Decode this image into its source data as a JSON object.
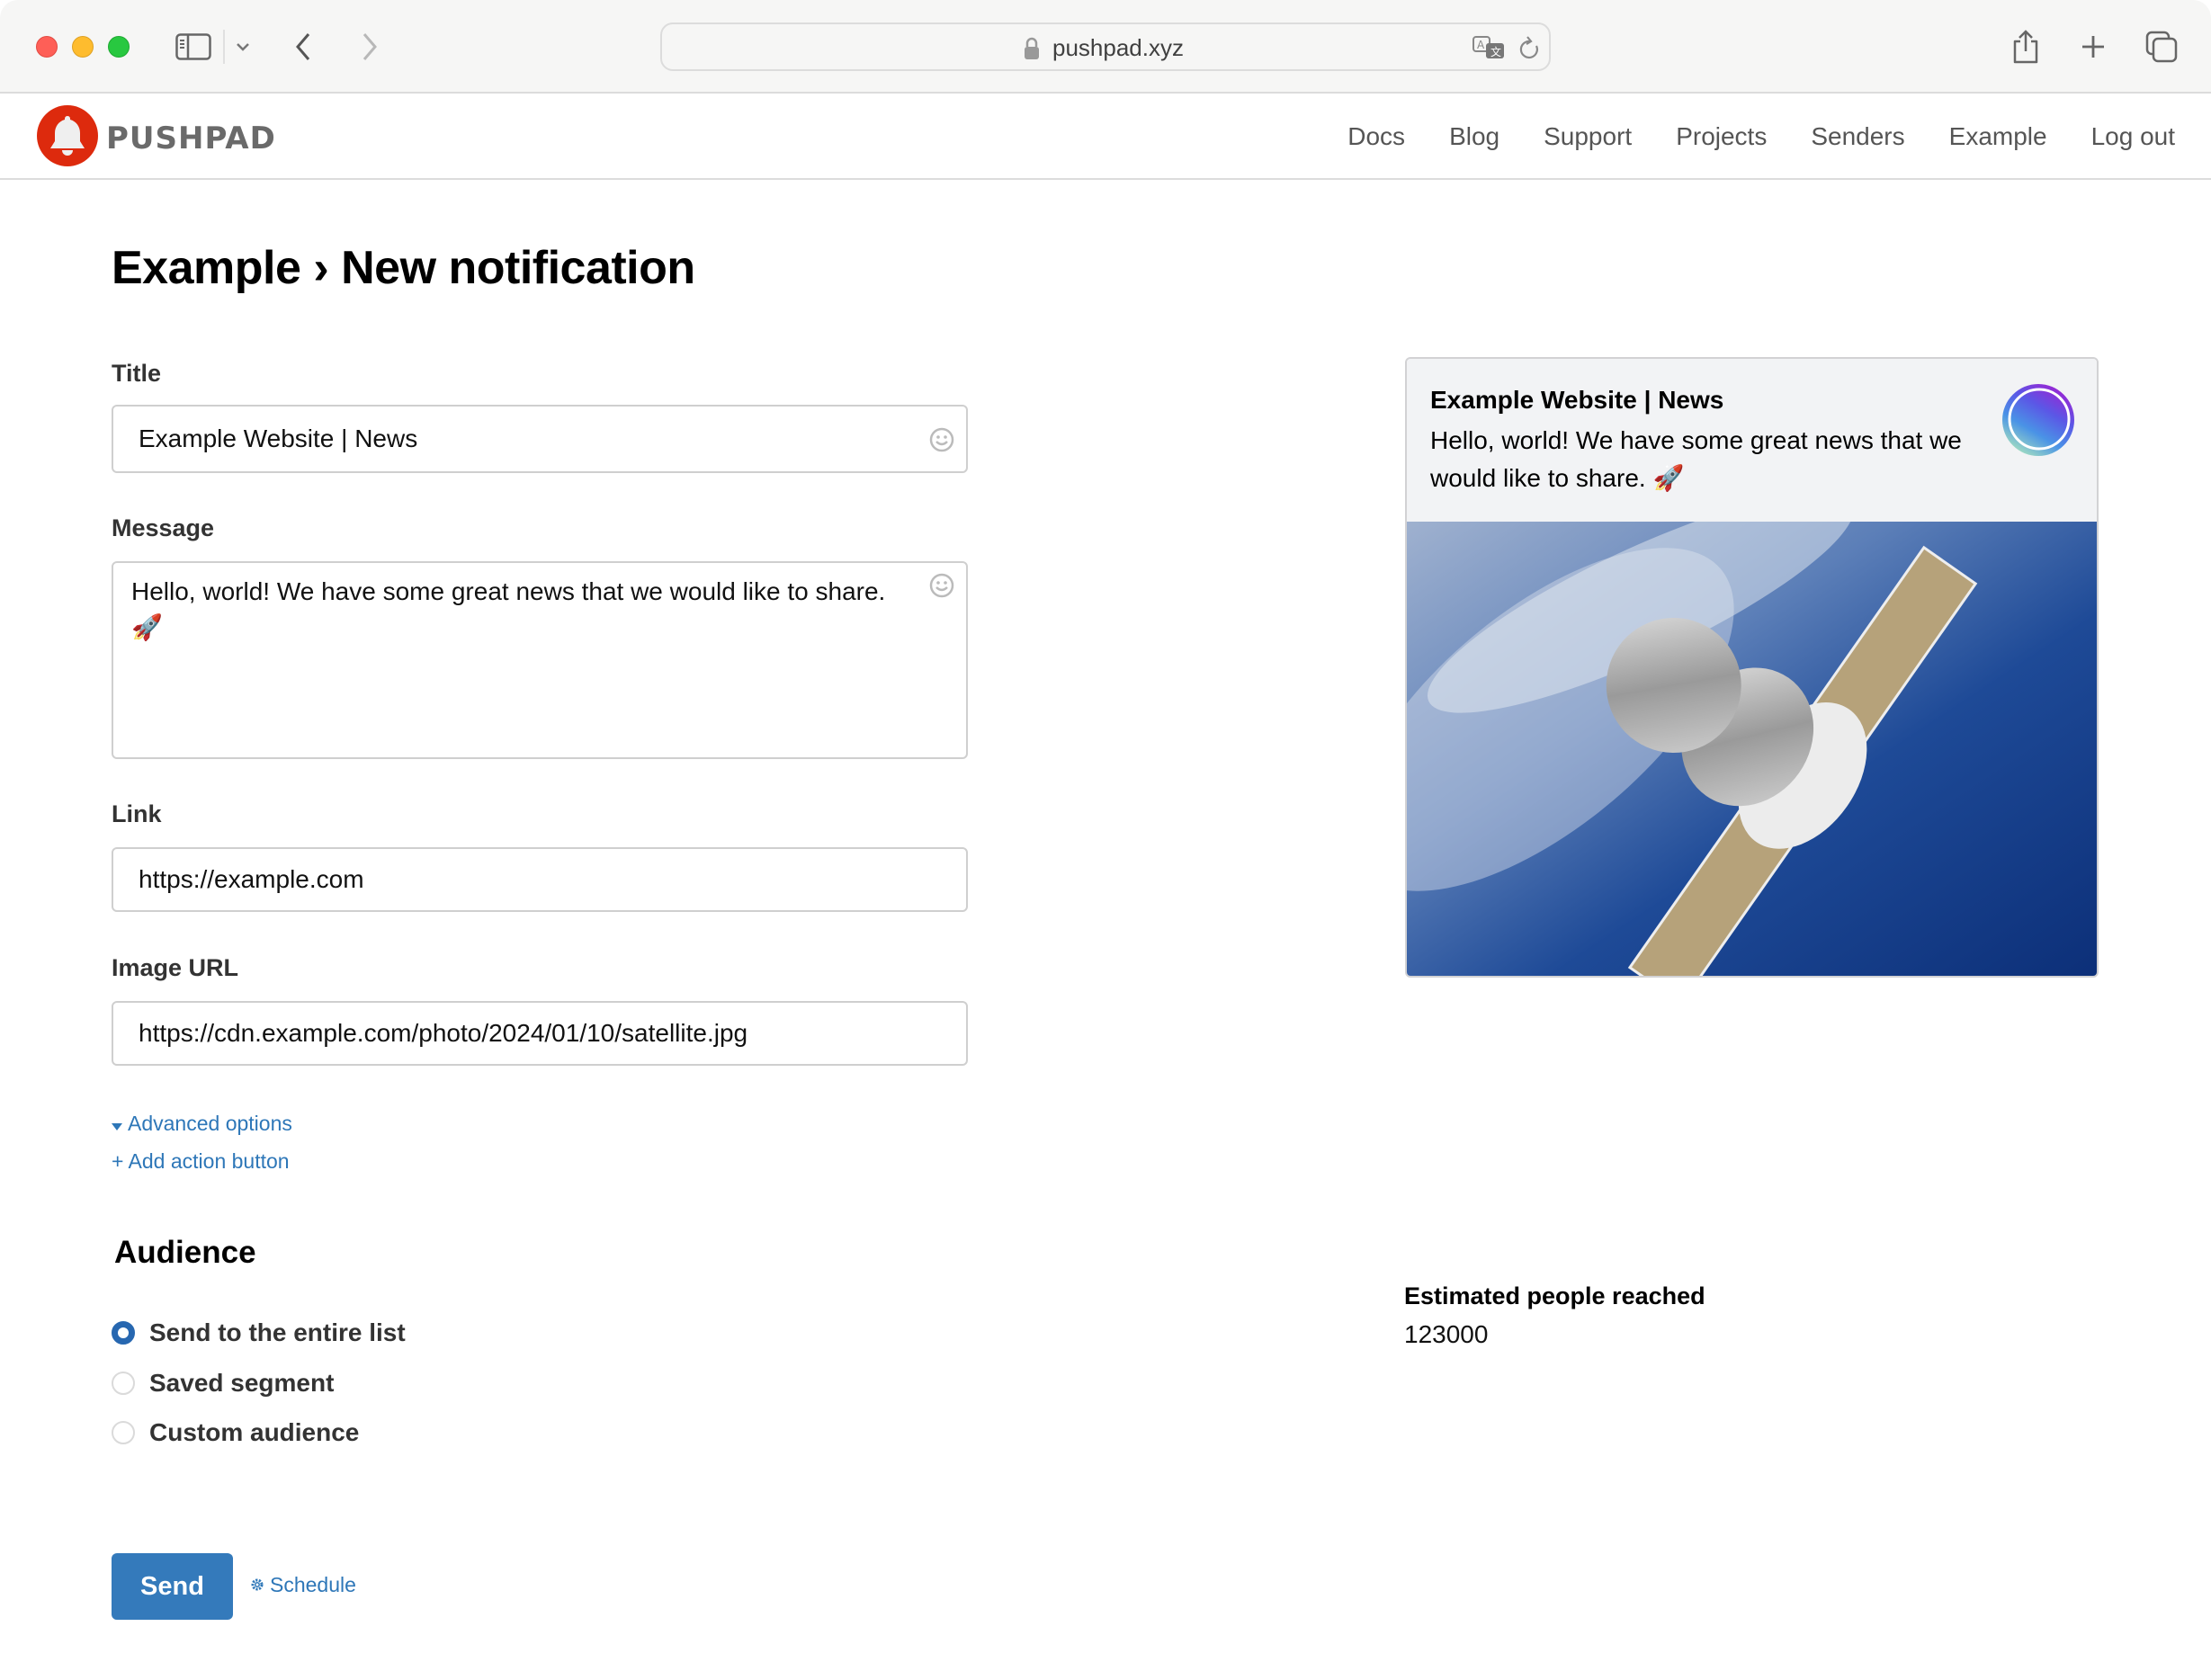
{
  "browser": {
    "url": "pushpad.xyz",
    "icons": {
      "sidebar": "sidebar-icon",
      "tab_overview_chevron": "chevron-down-icon",
      "back": "chevron-left-icon",
      "forward": "chevron-right-icon",
      "lock": "lock-icon",
      "translate": "translate-icon",
      "reload": "reload-icon",
      "share": "share-icon",
      "new_tab": "plus-icon",
      "tab_overview": "tabs-icon"
    }
  },
  "header": {
    "brand": "PUSHPAD",
    "brand_color": "#dd2a0d",
    "nav": [
      {
        "label": "Docs"
      },
      {
        "label": "Blog"
      },
      {
        "label": "Support"
      },
      {
        "label": "Projects"
      },
      {
        "label": "Senders"
      },
      {
        "label": "Example"
      },
      {
        "label": "Log out"
      }
    ]
  },
  "page": {
    "title": "Example › New notification"
  },
  "form": {
    "title": {
      "label": "Title",
      "value": "Example Website | News"
    },
    "message": {
      "label": "Message",
      "value": "Hello, world! We have some great news that we would like to share. 🚀"
    },
    "link": {
      "label": "Link",
      "value": "https://example.com"
    },
    "image_url": {
      "label": "Image URL",
      "value": "https://cdn.example.com/photo/2024/01/10/satellite.jpg"
    },
    "advanced_options": "Advanced options",
    "add_action_button": "+ Add action button",
    "link_color": "#2e77b8"
  },
  "audience": {
    "title": "Audience",
    "options": [
      {
        "label": "Send to the entire list",
        "checked": true
      },
      {
        "label": "Saved segment",
        "checked": false
      },
      {
        "label": "Custom audience",
        "checked": false
      }
    ],
    "accent_color": "#2767b0"
  },
  "actions": {
    "send": "Send",
    "schedule": "Schedule",
    "button_color": "#347abb"
  },
  "preview": {
    "title": "Example Website | News",
    "body": "Hello, world! We have some great news that we would like to share. 🚀",
    "icon": "gradient-circle-icon",
    "image": "satellite-photo"
  },
  "reach": {
    "label": "Estimated people reached",
    "value": "123000"
  }
}
